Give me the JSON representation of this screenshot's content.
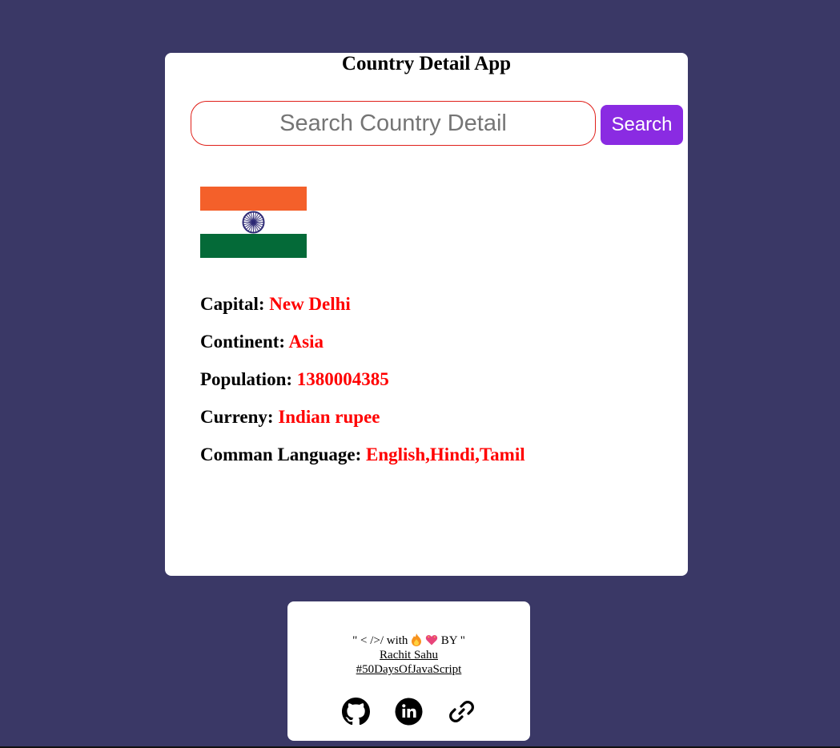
{
  "app": {
    "title": "Country Detail App"
  },
  "search": {
    "placeholder": "Search Country Detail",
    "value": "",
    "button_label": "Search"
  },
  "country": {
    "flag_icon": "india-flag",
    "colors": {
      "saffron": "#f4602a",
      "white": "#ffffff",
      "green": "#046a38",
      "chakra": "#2e2a75"
    },
    "fields": [
      {
        "label": "Capital:",
        "value": "New Delhi"
      },
      {
        "label": "Continent:",
        "value": "Asia"
      },
      {
        "label": "Population:",
        "value": "1380004385"
      },
      {
        "label": "Curreny:",
        "value": "Indian rupee"
      },
      {
        "label": "Comman Language:",
        "value": "English,Hindi,Tamil"
      }
    ]
  },
  "footer": {
    "made_prefix": "\" < />/ with",
    "made_suffix": "BY \"",
    "author": "Rachit Sahu",
    "hashtag": "#50DaysOfJavaScript",
    "social_icons": [
      "github-icon",
      "linkedin-icon",
      "link-icon"
    ]
  },
  "theme": {
    "background": "#3a3866",
    "accent": "#8a2be2",
    "value_color": "#ff0000"
  }
}
